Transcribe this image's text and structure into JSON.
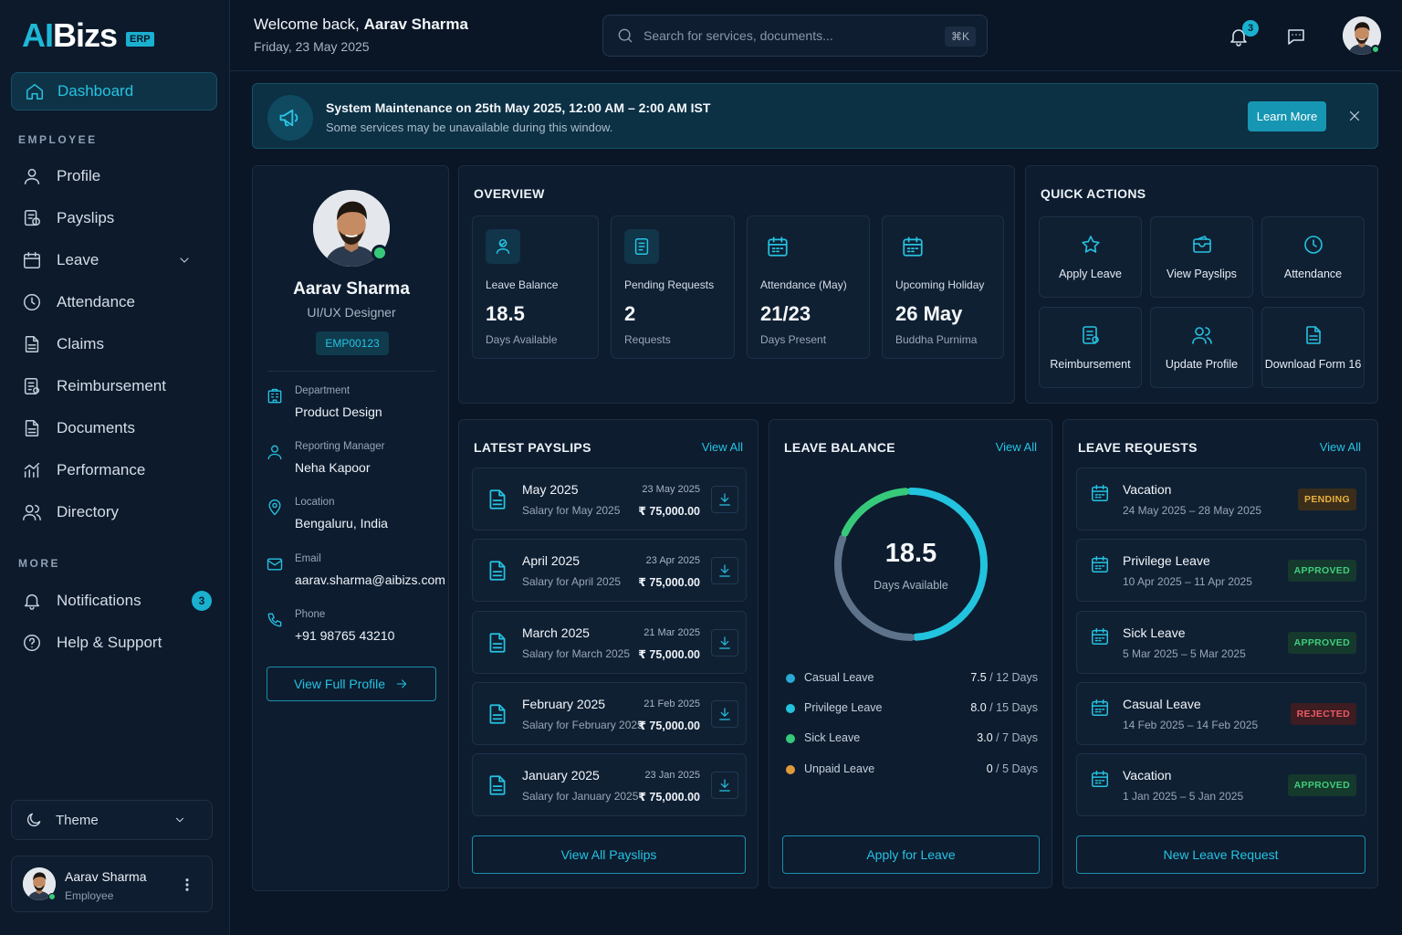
{
  "brand": {
    "logo_ai": "AI",
    "logo_rest": "Bizs",
    "badge": "ERP"
  },
  "sidebar": {
    "active": {
      "label": "Dashboard",
      "icon": "home-icon"
    },
    "section_employee": "EMPLOYEE",
    "items": [
      {
        "label": "Profile",
        "icon": "user-icon"
      },
      {
        "label": "Payslips",
        "icon": "payslip-icon"
      },
      {
        "label": "Leave",
        "icon": "calendar-icon"
      },
      {
        "label": "Attendance",
        "icon": "clock-icon"
      },
      {
        "label": "Claims",
        "icon": "document-icon"
      },
      {
        "label": "Reimbursement",
        "icon": "receipt-icon"
      },
      {
        "label": "Documents",
        "icon": "document-icon"
      },
      {
        "label": "Performance",
        "icon": "chart-icon"
      },
      {
        "label": "Directory",
        "icon": "users-icon"
      }
    ],
    "section_more": "MORE",
    "more_items": [
      {
        "label": "Notifications",
        "icon": "bell-icon",
        "badge": "3"
      },
      {
        "label": "Help & Support",
        "icon": "help-icon"
      }
    ],
    "theme_label": "Theme",
    "user": {
      "name": "Aarav Sharma",
      "role": "Employee"
    }
  },
  "header": {
    "welcome_prefix": "Welcome back,",
    "welcome_name": "Aarav Sharma",
    "date": "Friday, 23 May 2025",
    "search_placeholder": "Search for services, documents...",
    "search_shortcut": "⌘K",
    "notification_count": "3"
  },
  "banner": {
    "title": "System Maintenance on 25th May 2025, 12:00 AM – 2:00 AM IST",
    "subtitle": "Some services may be unavailable during this window.",
    "button": "Learn More"
  },
  "profile": {
    "name": "Aarav Sharma",
    "role": "UI/UX Designer",
    "emp_id": "EMP00123",
    "fields": [
      {
        "label": "Department",
        "value": "Product Design",
        "icon": "building-icon"
      },
      {
        "label": "Reporting Manager",
        "value": "Neha Kapoor",
        "icon": "user-icon"
      },
      {
        "label": "Location",
        "value": "Bengaluru, India",
        "icon": "pin-icon"
      },
      {
        "label": "Email",
        "value": "aarav.sharma@aibizs.com",
        "icon": "mail-icon"
      },
      {
        "label": "Phone",
        "value": "+91 98765 43210",
        "icon": "phone-icon"
      }
    ],
    "button": "View Full Profile"
  },
  "overview": {
    "title": "OVERVIEW",
    "tiles": [
      {
        "label": "Leave Balance",
        "value": "18.5",
        "sub": "Days Available",
        "icon": "user-check-icon"
      },
      {
        "label": "Pending Requests",
        "value": "2",
        "sub": "Requests",
        "icon": "list-icon"
      },
      {
        "label": "Attendance (May)",
        "value": "21/23",
        "sub": "Days Present",
        "icon": "calendar-icon"
      },
      {
        "label": "Upcoming Holiday",
        "value": "26 May",
        "sub": "Buddha Purnima",
        "icon": "calendar-icon"
      }
    ]
  },
  "quick_actions": {
    "title": "QUICK ACTIONS",
    "items": [
      {
        "label": "Apply Leave",
        "icon": "star-icon"
      },
      {
        "label": "View Payslips",
        "icon": "wallet-icon"
      },
      {
        "label": "Attendance",
        "icon": "clock-icon"
      },
      {
        "label": "Reimbursement",
        "icon": "receipt-icon"
      },
      {
        "label": "Update Profile",
        "icon": "users-icon"
      },
      {
        "label": "Download Form 16",
        "icon": "document-icon"
      }
    ]
  },
  "payslips": {
    "title": "LATEST PAYSLIPS",
    "view_all": "View All",
    "items": [
      {
        "month": "May 2025",
        "desc": "Salary for May 2025",
        "date": "23 May 2025",
        "amount": "₹ 75,000.00"
      },
      {
        "month": "April 2025",
        "desc": "Salary for April 2025",
        "date": "23 Apr 2025",
        "amount": "₹ 75,000.00"
      },
      {
        "month": "March 2025",
        "desc": "Salary for March 2025",
        "date": "21 Mar 2025",
        "amount": "₹ 75,000.00"
      },
      {
        "month": "February 2025",
        "desc": "Salary for February 2025",
        "date": "21 Feb 2025",
        "amount": "₹ 75,000.00"
      },
      {
        "month": "January 2025",
        "desc": "Salary for January 2025",
        "date": "23 Jan 2025",
        "amount": "₹ 75,000.00"
      }
    ],
    "button": "View All Payslips"
  },
  "leave_balance": {
    "title": "LEAVE BALANCE",
    "view_all": "View All",
    "total": "18.5",
    "total_label": "Days Available",
    "ring_fractions": {
      "cyan": 0.5,
      "green": 0.18,
      "grey": 0.32
    },
    "colors": {
      "cyan": "#22c3de",
      "green": "#37c97a",
      "grey": "#5e738a",
      "casual": "#2aa9d6",
      "privilege": "#22c3de",
      "sick": "#37c97a",
      "unpaid": "#e09a3a"
    },
    "types": [
      {
        "name": "Casual Leave",
        "used": "7.5",
        "total": "/ 12 Days",
        "color_key": "casual"
      },
      {
        "name": "Privilege Leave",
        "used": "8.0",
        "total": "/ 15 Days",
        "color_key": "privilege"
      },
      {
        "name": "Sick Leave",
        "used": "3.0",
        "total": "/ 7 Days",
        "color_key": "sick"
      },
      {
        "name": "Unpaid Leave",
        "used": "0",
        "total": "/ 5 Days",
        "color_key": "unpaid"
      }
    ],
    "button": "Apply for Leave"
  },
  "leave_requests": {
    "title": "LEAVE REQUESTS",
    "view_all": "View All",
    "items": [
      {
        "type": "Vacation",
        "dates": "24 May 2025 – 28 May 2025",
        "status": "PENDING",
        "status_class": "pending"
      },
      {
        "type": "Privilege Leave",
        "dates": "10 Apr 2025 – 11 Apr 2025",
        "status": "APPROVED",
        "status_class": "approved"
      },
      {
        "type": "Sick Leave",
        "dates": "5 Mar 2025 – 5 Mar 2025",
        "status": "APPROVED",
        "status_class": "approved"
      },
      {
        "type": "Casual Leave",
        "dates": "14 Feb 2025 – 14 Feb 2025",
        "status": "REJECTED",
        "status_class": "rejected"
      },
      {
        "type": "Vacation",
        "dates": "1 Jan 2025 – 5 Jan 2025",
        "status": "APPROVED",
        "status_class": "approved"
      }
    ],
    "button": "New Leave Request"
  }
}
